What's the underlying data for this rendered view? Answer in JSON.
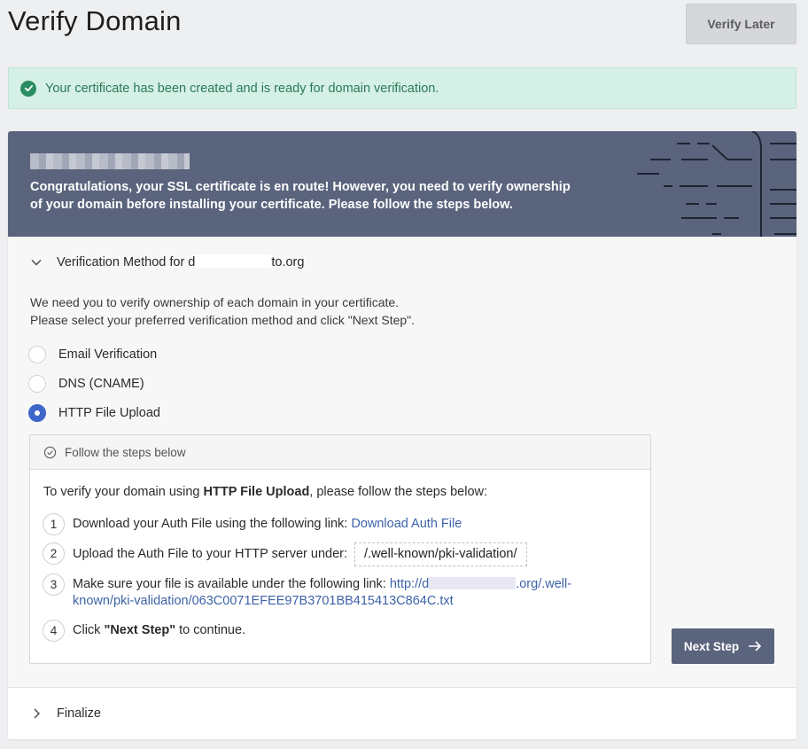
{
  "header": {
    "title": "Verify Domain",
    "verify_later_label": "Verify Later"
  },
  "alert": {
    "message": "Your certificate has been created and is ready for domain verification.",
    "icon": "check-circle-icon",
    "color": "#2a8c63"
  },
  "banner": {
    "text": "Congratulations, your SSL certificate is en route! However, you need to verify ownership of your domain before installing your certificate. Please follow the steps below.",
    "background": "#5b647d"
  },
  "verification": {
    "title_prefix": "Verification Method for d",
    "title_suffix": "to.org",
    "intro_line1": "We need you to verify ownership of each domain in your certificate.",
    "intro_line2": "Please select your preferred verification method and click \"Next Step\".",
    "options": [
      {
        "label": "Email Verification",
        "checked": false
      },
      {
        "label": "DNS (CNAME)",
        "checked": false
      },
      {
        "label": "HTTP File Upload",
        "checked": true
      }
    ]
  },
  "steps": {
    "header_label": "Follow the steps below",
    "intro_prefix": "To verify your domain using ",
    "intro_bold": "HTTP File Upload",
    "intro_suffix": ", please follow the steps below:",
    "items": [
      {
        "num": "1",
        "text": "Download your Auth File using the following link: ",
        "link": "Download Auth File"
      },
      {
        "num": "2",
        "text": "Upload the Auth File to your HTTP server under:",
        "path": "/.well-known/pki-validation/"
      },
      {
        "num": "3",
        "text": "Make sure your file is available under the following link: ",
        "link_prefix": "http://d",
        "link_suffix": ".org/.well-",
        "link_line2": "known/pki-validation/063C0071EFEE97B3701BB415413C864C.txt"
      },
      {
        "num": "4",
        "text_prefix": "Click ",
        "text_bold": "\"Next Step\"",
        "text_suffix": " to continue."
      }
    ]
  },
  "next_step_label": "Next Step",
  "finalize_label": "Finalize",
  "colors": {
    "accent": "#5b647d",
    "link": "#3e62a8",
    "radio_checked": "#3f67c9",
    "success_bg": "#d5f0e6"
  }
}
